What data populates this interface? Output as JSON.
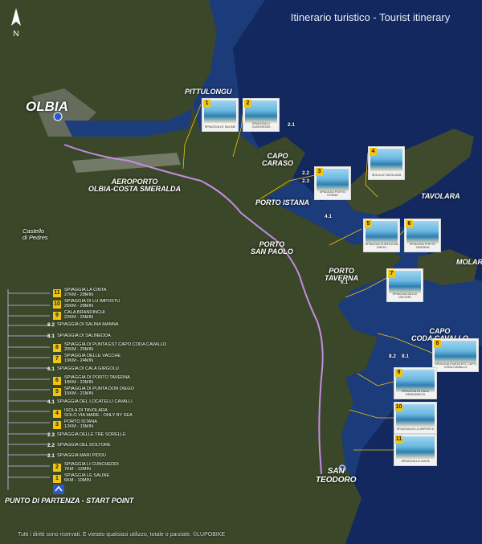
{
  "title": "Itinerario turistico - Tourist itinerary",
  "compass_label": "N",
  "colors": {
    "sea": "#1b3b7a",
    "deep_sea": "#0b1840",
    "land": "#3d4a2c",
    "route": "#c58be3",
    "badge": "#f1c40f",
    "connector": "#f1c40f"
  },
  "places": {
    "olbia": "OLBIA",
    "pittulongu": "PITTULONGU",
    "capo_caraso": "CAPO\nCARASO",
    "aeroporto": "AEROPORTO\nOLBIA-COSTA SMERALDA",
    "porto_istana": "PORTO ISTANA",
    "tavolara": "TAVOLARA",
    "porto_san_paolo": "PORTO\nSAN PAOLO",
    "castello": "Castello\ndi Pedres",
    "molara": "MOLARA",
    "porto_taverna": "PORTO\nTAVERNA",
    "capo_coda_cavallo": "CAPO\nCODA CAVALLO",
    "san_teodoro": "SAN\nTEODORO"
  },
  "point_labels": {
    "p21": "2.1",
    "p22": "2.2",
    "p23": "2.3",
    "p41": "4.1",
    "p61": "6.1",
    "p81": "8.1",
    "p82": "8.2"
  },
  "thumbnails": [
    {
      "num": "1",
      "caption": "SPIAGGIA LE SALINE"
    },
    {
      "num": "2",
      "caption": "SPIAGGIA LI CUNCHEDDI"
    },
    {
      "num": "3",
      "caption": "SPIAGGIA PORTO ISTANA"
    },
    {
      "num": "4",
      "caption": "ISOLA DI TAVOLARA"
    },
    {
      "num": "5",
      "caption": "SPIAGGIA PUNTA DON DIEGO"
    },
    {
      "num": "6",
      "caption": "SPIAGGIA PORTO TAVERNA"
    },
    {
      "num": "7",
      "caption": "SPIAGGIA DELLE VACCHE"
    },
    {
      "num": "8",
      "caption": "SPIAGGIA PUNTA EST CAPO CODA CAVALLO"
    },
    {
      "num": "9",
      "caption": "SPIAGGIA DI CALA BRANDINCHI"
    },
    {
      "num": "10",
      "caption": "SPIAGGIA DI LU IMPOSTU"
    },
    {
      "num": "11",
      "caption": "SPIAGGIA LA CINTA"
    }
  ],
  "legend": [
    {
      "code": "11",
      "text": "SPIAGGIA LA CINTA\n27KM - 28MIN"
    },
    {
      "code": "10",
      "text": "SPIAGGIA DI LU IMPOSTU\n25KM - 28MIN"
    },
    {
      "code": "9",
      "text": "CALA BRANDINCHI\n22KM - 25MIN"
    },
    {
      "code": "8.2",
      "text": "SPIAGGIA DI SALINA MANNA"
    },
    {
      "code": "8.1",
      "text": "SPIAGGIA DI SALINEDDA"
    },
    {
      "code": "8",
      "text": "SPIAGGIA DI PUNTA EST CAPO CODA CAVALLO\n20KM - 25MIN"
    },
    {
      "code": "7",
      "text": "SPIAGGIA DELLE VACCHE\n19KM - 24MIN"
    },
    {
      "code": "6.1",
      "text": "SPIAGGIA DI CALA GIRGOLU"
    },
    {
      "code": "6",
      "text": "SPIAGGIA DI PORTO TAVERNA\n18KM - 22MIN"
    },
    {
      "code": "5",
      "text": "SPIAGGIA DI PUNTA DON DIEGO\n15KM - 21MIN"
    },
    {
      "code": "4.1",
      "text": "SPIAGGIA DEL LOCATELLI CAVALLI"
    },
    {
      "code": "4",
      "text": "ISOLA DI TAVOLARA\nSOLO VIA MARE - ONLY BY SEA"
    },
    {
      "code": "3",
      "text": "PORTO ISTANA\n12KM - 15MIN"
    },
    {
      "code": "2.3",
      "text": "SPIAGGIA DELLE TRE SORELLE"
    },
    {
      "code": "2.2",
      "text": "SPIAGGIA DEL DOLTORE"
    },
    {
      "code": "2.1",
      "text": "SPIAGGIA MARI PIDDU"
    },
    {
      "code": "2",
      "text": "SPIAGGIA LI CUNCHEDDI\n7KM - 12MIN"
    },
    {
      "code": "1",
      "text": "SPIAGGIA LE SALINE\n6KM - 10MIN"
    }
  ],
  "start_point": "PUNTO DI PARTENZA - START POINT",
  "footer": "Tutti i diritti sono riservati. È vietato qualsiasi utilizzo, totale o parziale.  ©LUPOBIKE"
}
